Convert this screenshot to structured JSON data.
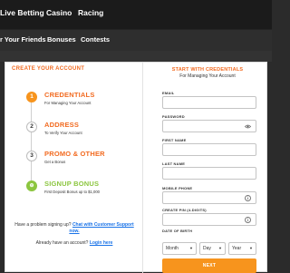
{
  "topnav": {
    "items": [
      "Live Betting",
      "Casino",
      "Racing"
    ]
  },
  "subnav": {
    "items": [
      "r Your Friends",
      "Bonuses",
      "Contests"
    ]
  },
  "left": {
    "title": "CREATE YOUR ACCOUNT",
    "steps": [
      {
        "num": "1",
        "label": "CREDENTIALS",
        "desc": "For Managing Your Account"
      },
      {
        "num": "2",
        "label": "ADDRESS",
        "desc": "To Verify Your Account"
      },
      {
        "num": "3",
        "label": "PROMO & OTHER",
        "desc": "Get a Bonus"
      },
      {
        "num": "⊕",
        "label": "SIGNUP BONUS",
        "desc": "First Deposit Bonus up to $1,000"
      }
    ],
    "help": {
      "q": "Have a problem signing up?",
      "link": "Chat with Customer Support",
      "tail": "now.",
      "account": "Already have an account?",
      "login": "Login here"
    }
  },
  "right": {
    "title": "START WITH CREDENTIALS",
    "subtitle": "For Managing Your Account",
    "fields": {
      "email": "EMAIL",
      "password": "PASSWORD",
      "first_name": "FIRST NAME",
      "last_name": "LAST NAME",
      "mobile": "MOBILE PHONE",
      "pin": "CREATE PIN (4-DIGITS)",
      "dob": "DATE OF BIRTH"
    },
    "dob_selects": {
      "month": "Month",
      "day": "Day",
      "year": "Year"
    },
    "next": "NEXT"
  },
  "icons": {
    "eye": "eye-icon",
    "info": "info-icon",
    "chevron": "chevron-down-icon"
  }
}
